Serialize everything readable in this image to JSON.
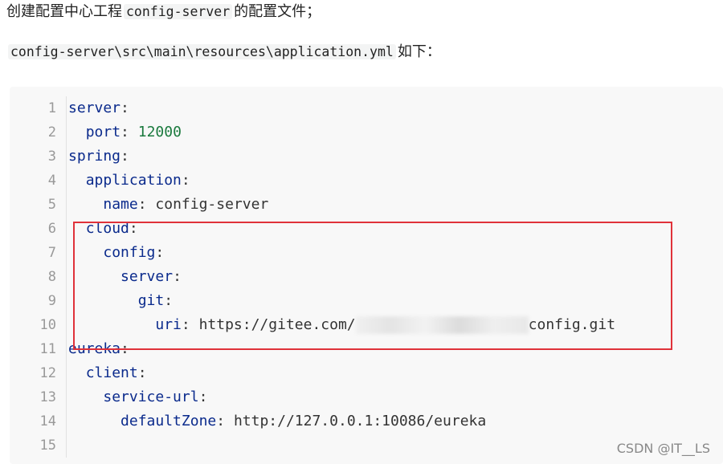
{
  "intro": {
    "prefix": "创建配置中心工程",
    "project_code": "config-server",
    "suffix": "的配置文件；"
  },
  "file": {
    "path": "config-server\\src\\main\\resources\\application.yml",
    "suffix": "如下："
  },
  "code": {
    "line_numbers": [
      "1",
      "2",
      "3",
      "4",
      "5",
      "6",
      "7",
      "8",
      "9",
      "10",
      "11",
      "12",
      "13",
      "14",
      "15"
    ],
    "lines": [
      {
        "indent": "",
        "key": "server",
        "sep": ":",
        "value": "",
        "value_type": ""
      },
      {
        "indent": "  ",
        "key": "port",
        "sep": ": ",
        "value": "12000",
        "value_type": "number"
      },
      {
        "indent": "",
        "key": "spring",
        "sep": ":",
        "value": "",
        "value_type": ""
      },
      {
        "indent": "  ",
        "key": "application",
        "sep": ":",
        "value": "",
        "value_type": ""
      },
      {
        "indent": "    ",
        "key": "name",
        "sep": ": ",
        "value": "config-server",
        "value_type": "string"
      },
      {
        "indent": "  ",
        "key": "cloud",
        "sep": ":",
        "value": "",
        "value_type": ""
      },
      {
        "indent": "    ",
        "key": "config",
        "sep": ":",
        "value": "",
        "value_type": ""
      },
      {
        "indent": "      ",
        "key": "server",
        "sep": ":",
        "value": "",
        "value_type": ""
      },
      {
        "indent": "        ",
        "key": "git",
        "sep": ":",
        "value": "",
        "value_type": ""
      },
      {
        "indent": "          ",
        "key": "uri",
        "sep": ": ",
        "value_prefix": "https://gitee.com/",
        "value_suffix": "config.git",
        "value_type": "redacted"
      },
      {
        "indent": "",
        "key": "eureka",
        "sep": ":",
        "value": "",
        "value_type": ""
      },
      {
        "indent": "  ",
        "key": "client",
        "sep": ":",
        "value": "",
        "value_type": ""
      },
      {
        "indent": "    ",
        "key": "service-url",
        "sep": ":",
        "value": "",
        "value_type": ""
      },
      {
        "indent": "      ",
        "key": "defaultZone",
        "sep": ": ",
        "value": "http://127.0.0.1:10086/eureka",
        "value_type": "string"
      },
      {
        "indent": "",
        "key": "",
        "sep": "",
        "value": "",
        "value_type": ""
      }
    ]
  },
  "watermark": "CSDN @IT__LS",
  "colors": {
    "key": "#0a2a8c",
    "number": "#1b7a3e",
    "highlight_border": "#e0323a",
    "code_bg": "#f8f8f8"
  }
}
